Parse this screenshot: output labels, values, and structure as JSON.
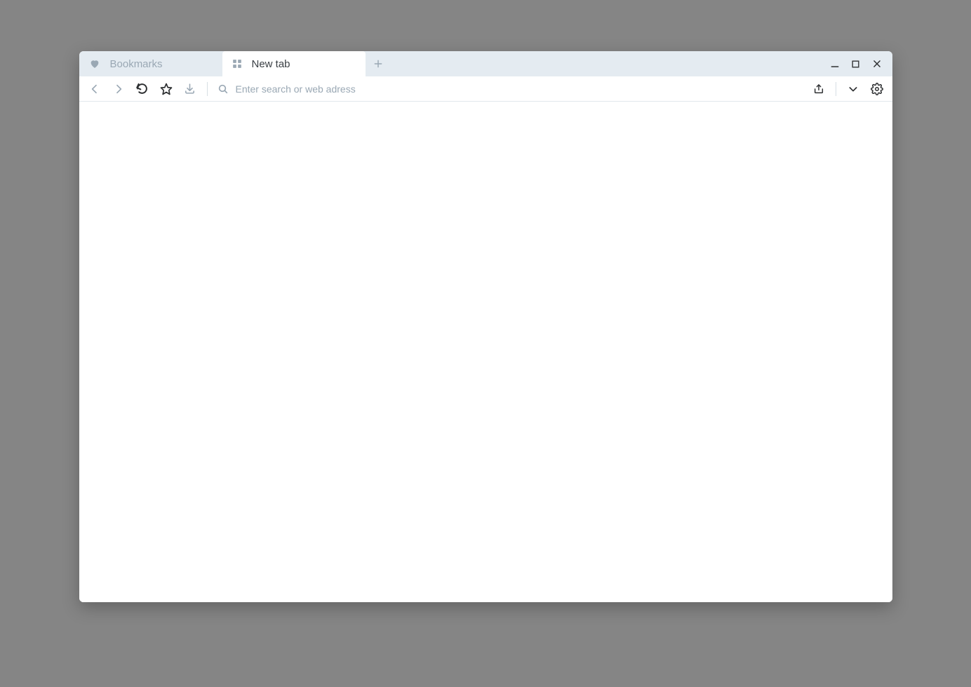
{
  "tabs": [
    {
      "label": "Bookmarks",
      "icon": "heart",
      "active": false
    },
    {
      "label": "New tab",
      "icon": "grid",
      "active": true
    }
  ],
  "address_bar": {
    "placeholder": "Enter search or web adress",
    "value": ""
  },
  "colors": {
    "tab_bar_bg": "#e4ebf1",
    "muted_icon": "#9aa8b4",
    "dark_icon": "#2d2f31",
    "text_active": "#3a3f44",
    "canvas_bg": "#858585"
  }
}
